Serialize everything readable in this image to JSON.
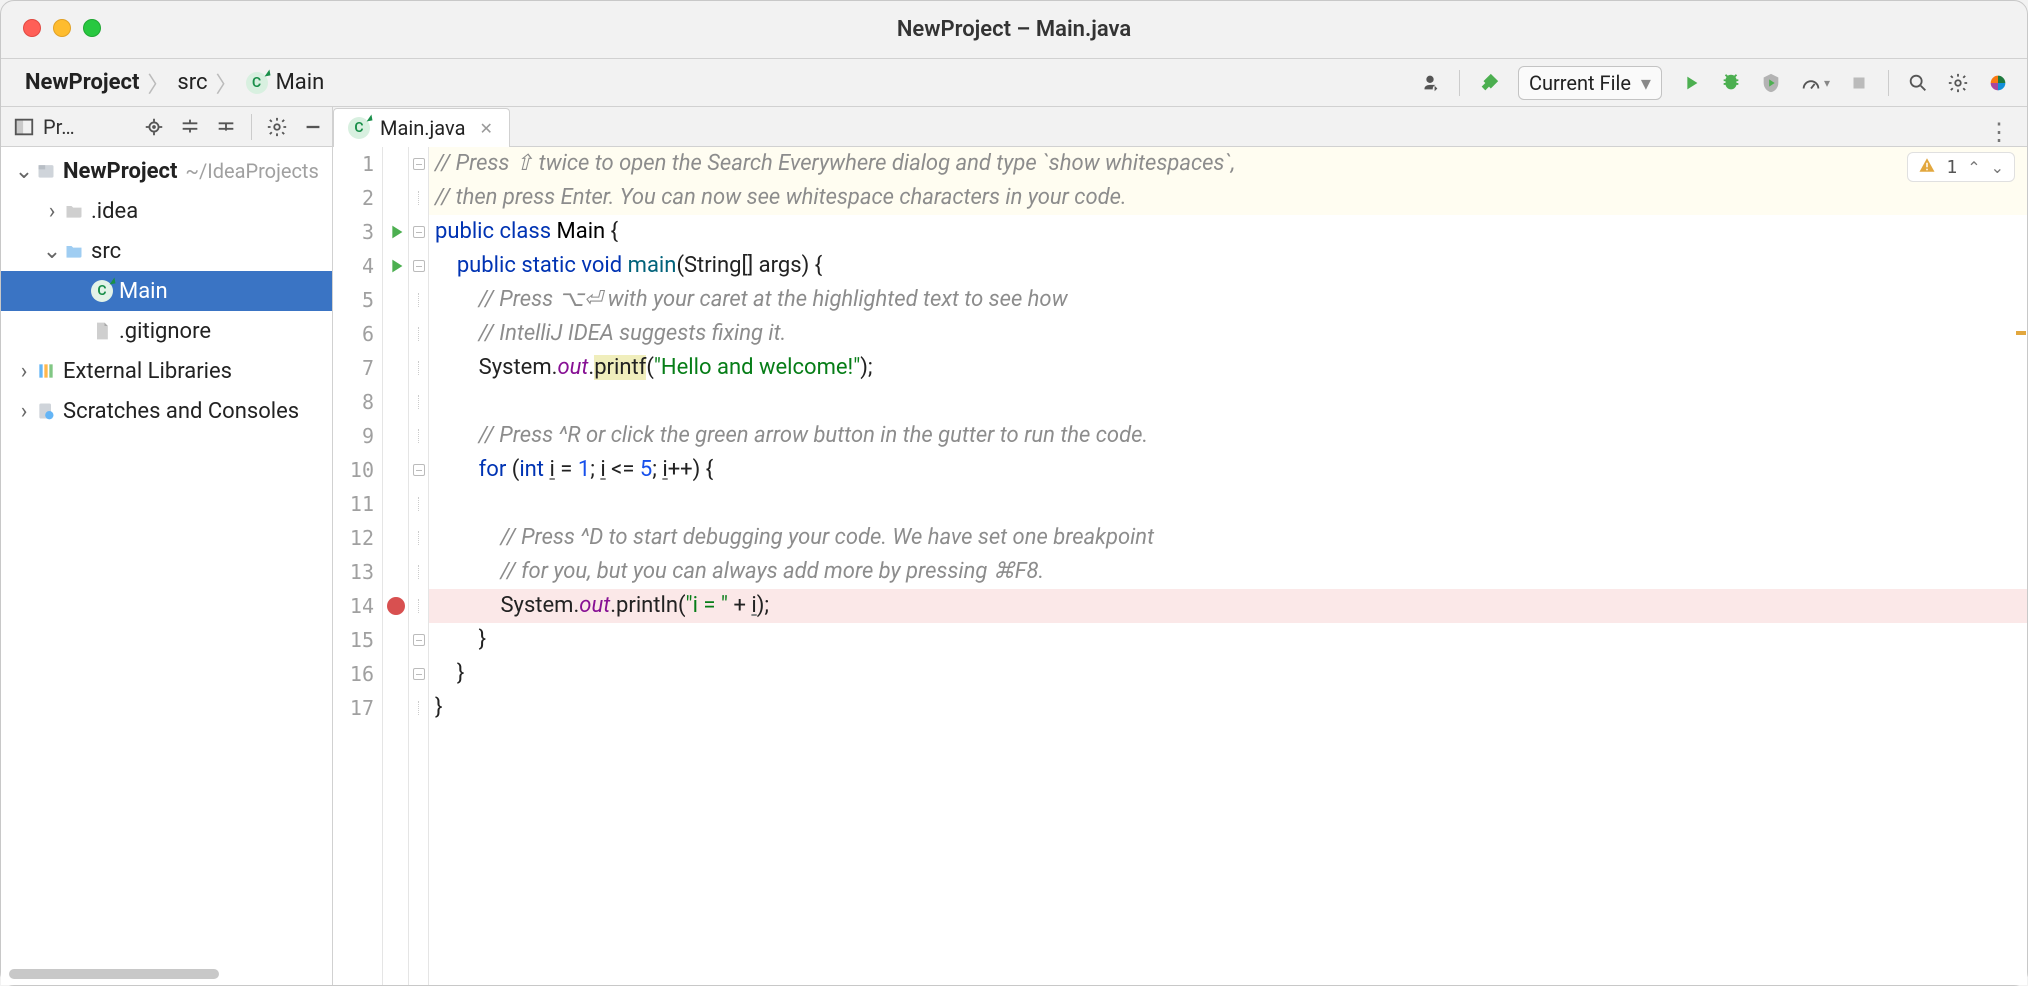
{
  "window": {
    "title": "NewProject – Main.java"
  },
  "breadcrumbs": {
    "project": "NewProject",
    "src": "src",
    "file": "Main"
  },
  "toolbar": {
    "run_config": "Current File"
  },
  "sidebar": {
    "header_label": "Pr…",
    "tree": {
      "root_name": "NewProject",
      "root_hint": "~/IdeaProjects",
      "idea": ".idea",
      "src": "src",
      "main": "Main",
      "gitignore": ".gitignore",
      "ext_libs": "External Libraries",
      "scratches": "Scratches and Consoles"
    }
  },
  "tabs": {
    "main": "Main.java"
  },
  "inspection": {
    "count": "1"
  },
  "code": {
    "lines": [
      {
        "n": "1",
        "hint": true,
        "type": "comment",
        "text": "// Press ⇧ twice to open the Search Everywhere dialog and type `show whitespaces`,",
        "fold": "open"
      },
      {
        "n": "2",
        "hint": true,
        "type": "comment",
        "text": "// then press Enter. You can now see whitespace characters in your code.",
        "fold": "dash"
      },
      {
        "n": "3",
        "run": true,
        "fold": "open",
        "html": "<span class='kw'>public class</span> <span class='fname'>Main</span> {"
      },
      {
        "n": "4",
        "run": true,
        "fold": "open",
        "html": "    <span class='kw'>public static</span> <span class='kw'>void</span> <span style='color:#00627a'>main</span>(String[] args) {"
      },
      {
        "n": "5",
        "fold": "dash",
        "type": "comment",
        "html": "        <span class='cm'>// Press ⌥⏎ with your caret at the highlighted text to see how</span>"
      },
      {
        "n": "6",
        "fold": "dash",
        "type": "comment",
        "html": "        <span class='cm'>// IntelliJ IDEA suggests fixing it.</span>"
      },
      {
        "n": "7",
        "fold": "dash",
        "html": "        System.<span class='stat'>out</span>.<span class='hl'>printf</span>(<span class='str'>\"Hello and welcome!\"</span>);"
      },
      {
        "n": "8",
        "fold": "dash",
        "html": ""
      },
      {
        "n": "9",
        "fold": "dash",
        "type": "comment",
        "html": "        <span class='cm'>// Press ^R or click the green arrow button in the gutter to run the code.</span>"
      },
      {
        "n": "10",
        "fold": "open",
        "html": "        <span class='kw'>for</span> (<span class='kw'>int</span> <span class='und'>i</span> = <span style='color:#1750eb'>1</span>; <span class='und'>i</span> &lt;= <span style='color:#1750eb'>5</span>; <span class='und'>i</span>++) {"
      },
      {
        "n": "11",
        "fold": "dash",
        "html": ""
      },
      {
        "n": "12",
        "fold": "dash",
        "type": "comment",
        "html": "            <span class='cm'>// Press ^D to start debugging your code. We have set one breakpoint</span>"
      },
      {
        "n": "13",
        "fold": "dash",
        "type": "comment",
        "html": "            <span class='cm'>// for you, but you can always add more by pressing ⌘F8.</span>"
      },
      {
        "n": "14",
        "bp": true,
        "fold": "dash",
        "html": "            System.<span class='stat'>out</span>.println(<span class='str'>\"i = \"</span> + <span class='und'>i</span>);"
      },
      {
        "n": "15",
        "fold": "open",
        "html": "        }"
      },
      {
        "n": "16",
        "fold": "open",
        "html": "    }"
      },
      {
        "n": "17",
        "fold": "dash",
        "html": "}"
      }
    ]
  }
}
